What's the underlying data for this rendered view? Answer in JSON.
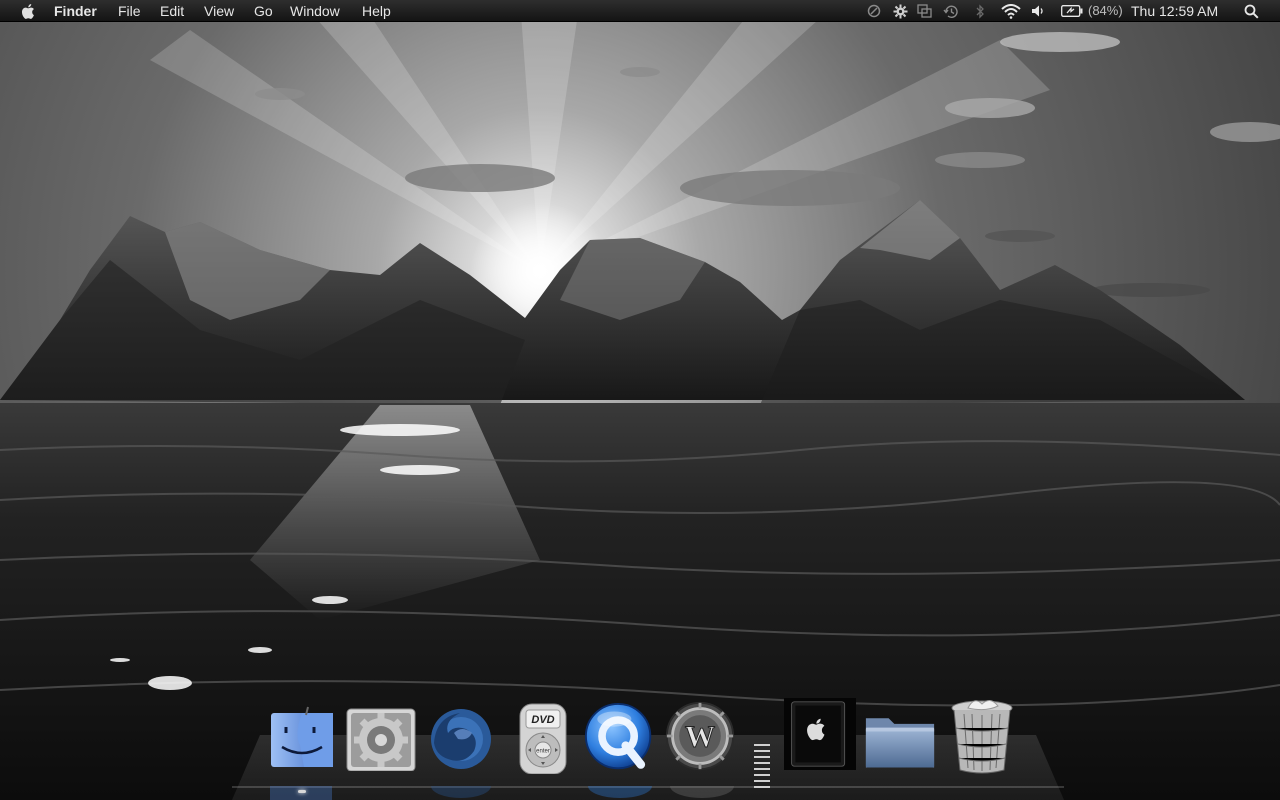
{
  "menubar": {
    "apple_icon": "apple-logo-icon",
    "app_name": "Finder",
    "menus": [
      "File",
      "Edit",
      "View",
      "Go",
      "Window",
      "Help"
    ],
    "status_icons": [
      "sync-icon",
      "gear-badge-icon",
      "window-icon",
      "time-machine-icon",
      "bluetooth-icon",
      "wifi-icon",
      "volume-icon",
      "battery-icon"
    ],
    "battery_percent": "(84%)",
    "clock": "Thu 12:59 AM",
    "spotlight_icon": "spotlight-search-icon"
  },
  "desktop": {
    "wallpaper": "grayscale mountains at sunset over ocean"
  },
  "dock": {
    "items": [
      {
        "name": "Finder",
        "icon": "finder-icon",
        "running": true
      },
      {
        "name": "System Preferences",
        "icon": "system-preferences-icon",
        "running": false
      },
      {
        "name": "Firefox",
        "icon": "firefox-icon",
        "running": false
      },
      {
        "name": "DVD Player",
        "icon": "dvd-player-icon",
        "running": false
      },
      {
        "name": "QuickTime Player",
        "icon": "quicktime-icon",
        "running": false
      },
      {
        "name": "World of Warcraft",
        "icon": "warcraft-icon",
        "running": false
      },
      {
        "name": "Applications",
        "icon": "apple-stack-icon",
        "running": false
      },
      {
        "name": "Documents",
        "icon": "folder-icon",
        "running": false
      },
      {
        "name": "Trash",
        "icon": "trash-icon",
        "running": false
      }
    ],
    "dvd_label": "DVD",
    "dvd_enter_label": "enter",
    "warcraft_letter": "W"
  },
  "colors": {
    "menubar": "#1e1e1e",
    "menubar_text": "#e6e6e6",
    "quicktime_blue": "#2f7fe0",
    "finder_blue": "#4a7fd4"
  }
}
